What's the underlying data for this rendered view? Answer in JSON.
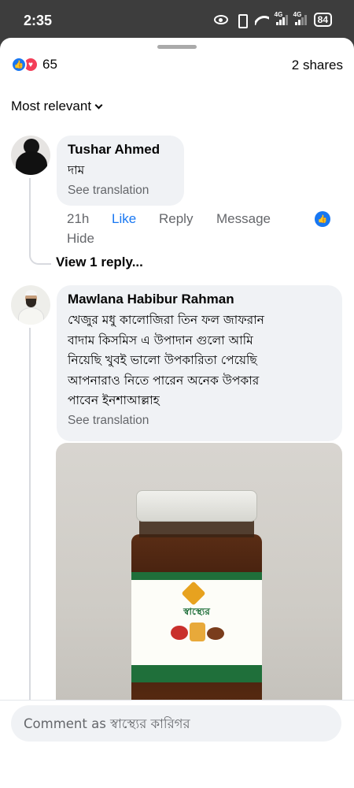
{
  "status_bar": {
    "time": "2:35",
    "signal_1_label": "4G",
    "signal_2_label": "4G",
    "battery": "84"
  },
  "reactions": {
    "count": "65",
    "shares": "2 shares",
    "icons": [
      "like-icon",
      "love-icon"
    ]
  },
  "sort": {
    "label": "Most relevant"
  },
  "comments": [
    {
      "author": "Tushar Ahmed",
      "text": "দাম",
      "see_translation": "See translation",
      "time": "21h",
      "like_label": "Like",
      "reply_label": "Reply",
      "message_label": "Message",
      "like_count": "1",
      "hide_label": "Hide",
      "view_replies": "View 1 reply..."
    },
    {
      "author": "Mawlana Habibur Rahman",
      "text_lines": [
        "খেজুর মধু কালোজিরা তিন ফল জাফরান",
        "বাদাম কিসমিস এ উপাদান গুলো আমি",
        "নিয়েছি খুবই ভালো উপকারিতা পেয়েছি",
        "আপনারাও নিতে পারেন অনেক উপকার",
        "পাবেন ইনশাআল্লাহ"
      ],
      "see_translation": "See translation",
      "photo": {
        "label_brand": "স্বাস্থ্যের"
      }
    }
  ],
  "composer": {
    "placeholder": "Comment as স্বাস্থ্যের কারিগর"
  },
  "colors": {
    "accent": "#1877f2",
    "love": "#f33e58",
    "bubble": "#f0f2f5",
    "muted_text": "#65676b"
  }
}
